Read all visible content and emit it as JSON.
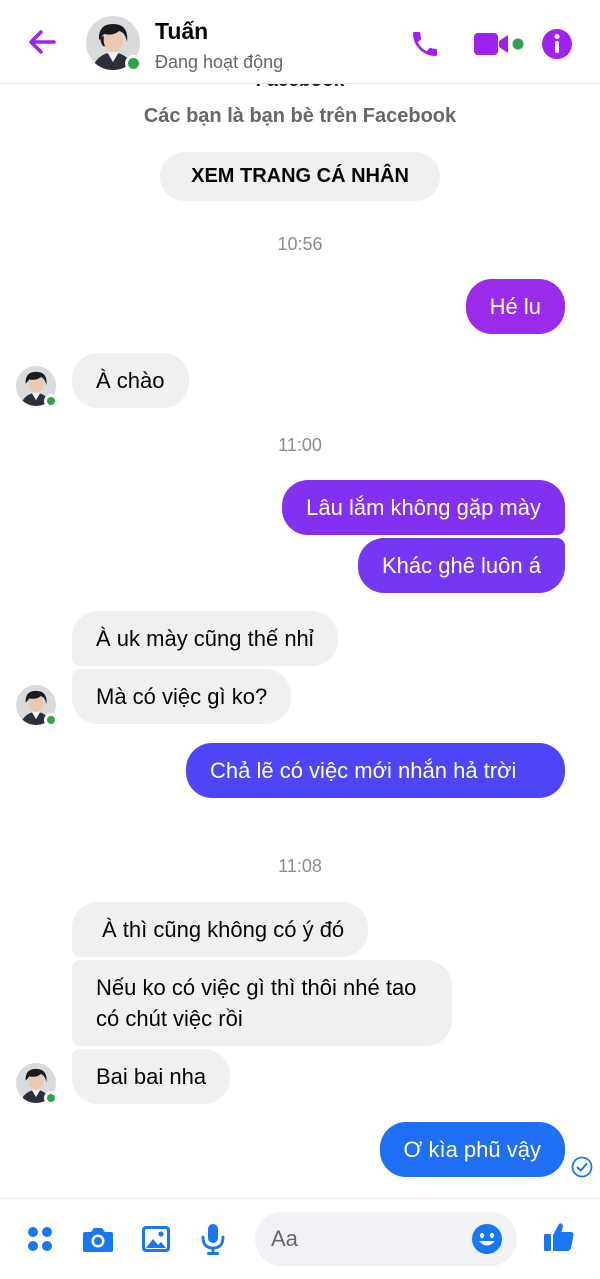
{
  "colors": {
    "accent": "#a020f0",
    "gradient_top": "#8a2ee8",
    "gradient_mid": "#5b3df5",
    "gradient_bottom": "#1877f2",
    "online": "#31a24c"
  },
  "header": {
    "contact_name": "Tuấn",
    "status": "Đang hoạt động",
    "icons": [
      "back-arrow-icon",
      "phone-icon",
      "video-camera-icon",
      "info-icon"
    ]
  },
  "conversation": {
    "clipped_title": "Facebook",
    "friends_text": "Các bạn là bạn bè trên Facebook",
    "profile_button": "XEM TRANG CÁ NHÂN",
    "timestamps": [
      "10:56",
      "11:00",
      "11:08"
    ],
    "messages": [
      {
        "from": "me",
        "text": "Hé lu"
      },
      {
        "from": "them",
        "text": "À chào"
      },
      {
        "from": "me",
        "text": "Lâu lắm không gặp mày"
      },
      {
        "from": "me",
        "text": "Khác ghê luôn á"
      },
      {
        "from": "them",
        "text": "À uk mày cũng thế nhỉ"
      },
      {
        "from": "them",
        "text": "Mà có việc gì ko?"
      },
      {
        "from": "me",
        "text": "Chả lẽ có việc mới nhắn hả trời"
      },
      {
        "from": "them",
        "text": "À thì cũng không có ý đó"
      },
      {
        "from": "them",
        "text": "Nếu ko có việc gì thì thôi nhé tao có chút việc rồi"
      },
      {
        "from": "them",
        "text": "Bai bai nha"
      },
      {
        "from": "me",
        "text": "Ơ kìa phũ vậy"
      }
    ]
  },
  "composer": {
    "placeholder": "Aa",
    "icons": [
      "apps-grid-icon",
      "camera-icon",
      "gallery-icon",
      "microphone-icon",
      "emoji-icon",
      "like-icon"
    ]
  }
}
